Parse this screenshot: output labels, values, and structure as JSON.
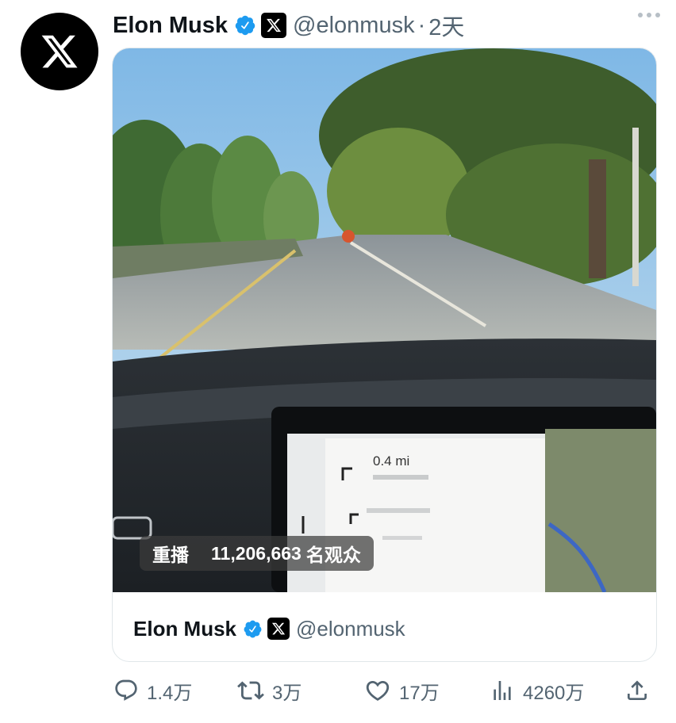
{
  "tweet": {
    "author_name": "Elon Musk",
    "handle": "@elonmusk",
    "separator": "·",
    "time": "2天"
  },
  "video": {
    "replay_label": "重播",
    "views_count": "11,206,663",
    "views_suffix": "名观众",
    "nav_distance": "0.4 mi"
  },
  "quoted": {
    "author_name": "Elon Musk",
    "handle": "@elonmusk"
  },
  "actions": {
    "replies": "1.4万",
    "retweets": "3万",
    "likes": "17万",
    "views": "4260万"
  },
  "colors": {
    "verified": "#1d9bf0",
    "secondary_text": "#536471",
    "border": "#e1e7ea"
  },
  "icons": [
    "x-logo-icon",
    "verified-badge-icon",
    "x-affiliate-badge-icon",
    "more-icon",
    "reply-icon",
    "retweet-icon",
    "like-icon",
    "views-icon",
    "share-icon"
  ]
}
